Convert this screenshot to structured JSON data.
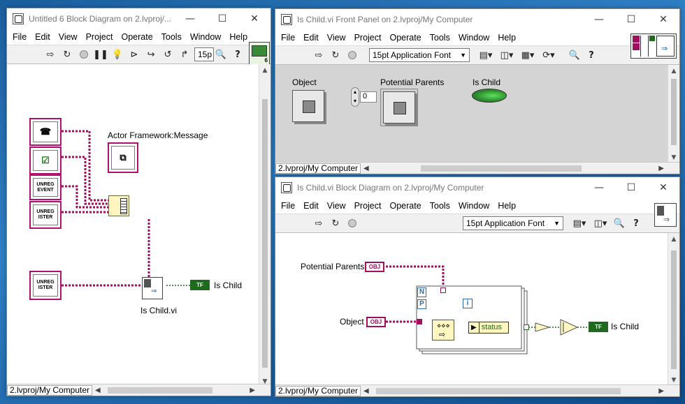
{
  "left_window": {
    "title": "Untitled 6 Block Diagram on 2.lvproj/...",
    "menu": [
      "File",
      "Edit",
      "View",
      "Project",
      "Operate",
      "Tools",
      "Window",
      "Help"
    ],
    "font_size": "15p",
    "node_labels": {
      "message": "Actor Framework:Message",
      "subvi": "Is Child.vi",
      "indicator": "Is Child"
    },
    "node_texts": [
      "UNREG EVENT",
      "UNREG ISTER",
      "UNREG ISTER"
    ],
    "status_project": "2.lvproj/My Computer"
  },
  "front_panel": {
    "title": "Is Child.vi Front Panel on 2.lvproj/My Computer",
    "menu": [
      "File",
      "Edit",
      "View",
      "Project",
      "Operate",
      "Tools",
      "Window",
      "Help"
    ],
    "font": "15pt Application Font",
    "controls": {
      "object": "Object",
      "potential_parents": "Potential Parents",
      "index_value": "0",
      "is_child": "Is Child"
    },
    "status_project": "2.lvproj/My Computer"
  },
  "block_diagram": {
    "title": "Is Child.vi Block Diagram on 2.lvproj/My Computer",
    "menu": [
      "File",
      "Edit",
      "View",
      "Project",
      "Operate",
      "Tools",
      "Window",
      "Help"
    ],
    "font": "15pt Application Font",
    "labels": {
      "potential_parents": "Potential Parents",
      "object": "Object",
      "is_child": "Is Child",
      "status": "status",
      "obj_tag": "OBJ",
      "tf_tag": "TF",
      "n": "N",
      "p": "P",
      "i": "i"
    },
    "status_project": "2.lvproj/My Computer"
  },
  "colors": {
    "class_wire": "#a0105f",
    "bool_wire": "#1f6a1f",
    "background": "#2f7fc4"
  }
}
